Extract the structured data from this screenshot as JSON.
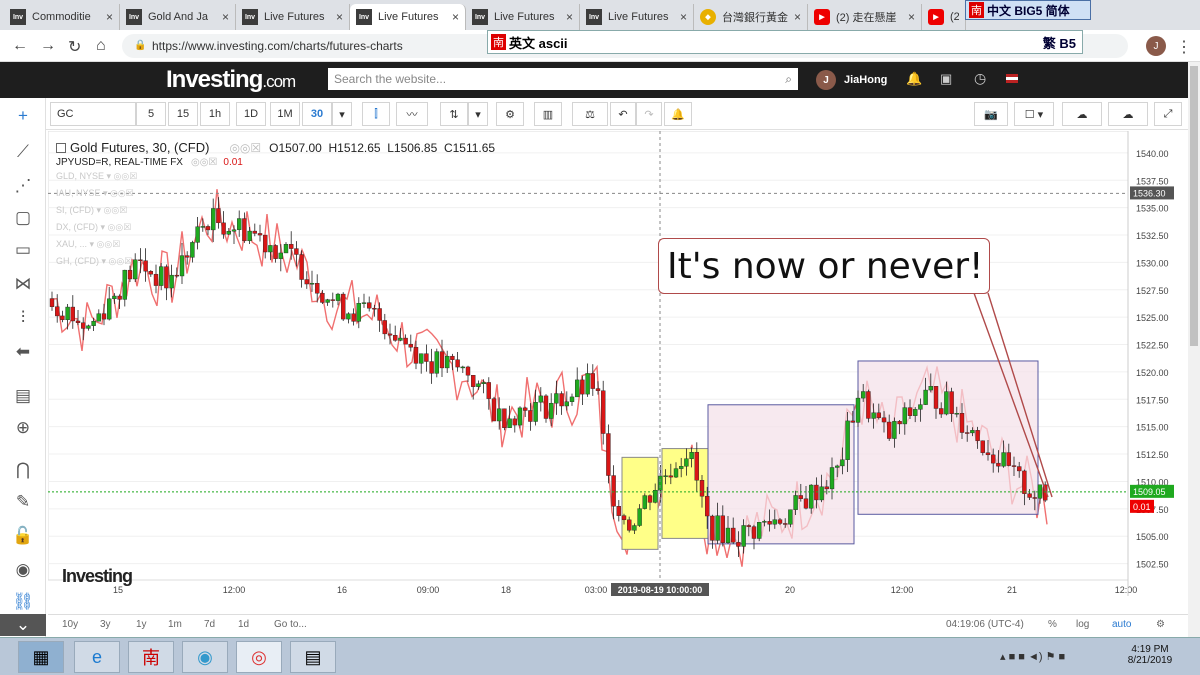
{
  "tabs": [
    {
      "fav": "Inv",
      "title": "Commoditie",
      "x": 4,
      "w": 116
    },
    {
      "fav": "Inv",
      "title": "Gold And Ja",
      "x": 120,
      "w": 116
    },
    {
      "fav": "Inv",
      "title": "Live Futures",
      "x": 236,
      "w": 114
    },
    {
      "fav": "Inv",
      "title": "Live Futures",
      "x": 350,
      "w": 116,
      "active": true
    },
    {
      "fav": "Inv",
      "title": "Live Futures",
      "x": 466,
      "w": 114
    },
    {
      "fav": "Inv",
      "title": "Live Futures",
      "x": 580,
      "w": 114
    },
    {
      "fav": "gem",
      "title": "台灣銀行黃金",
      "x": 694,
      "w": 114
    },
    {
      "fav": "yt",
      "title": "(2) 走在懸崖",
      "x": 808,
      "w": 114
    },
    {
      "fav": "yt",
      "title": "(2)",
      "x": 922,
      "w": 44
    }
  ],
  "ime_top": {
    "nan": "南",
    "text": "中文 BIG5 简体"
  },
  "ime_bar": {
    "nan": "南",
    "text": "英文 ascii",
    "right": "繁 B5"
  },
  "browser": {
    "url": "https://www.investing.com/charts/futures-charts"
  },
  "site": {
    "logo": "Investing",
    "logo_suffix": ".com",
    "search_placeholder": "Search the website...",
    "user_initial": "J",
    "user_name": "JiaHong"
  },
  "toolbar": {
    "symbol": "GC",
    "intervals": [
      "5",
      "15",
      "1h",
      "1D",
      "1M",
      "30"
    ],
    "active_interval": "30"
  },
  "legend": {
    "title": "Gold Futures, 30, (CFD)",
    "ohlc": "O1507.00  H1512.65  L1506.85  C1511.65",
    "overlay": "JPYUSD=R, REAL-TIME FX",
    "overlay_val": "0.01",
    "faded": [
      "GLD, NYSE",
      "IAU, NYSE",
      "SI, (CFD)",
      "DX, (CFD)",
      "XAU, ...",
      "GH, (CFD)"
    ]
  },
  "annotation": {
    "text": "It's now or never!"
  },
  "chart_data": {
    "type": "candlestick",
    "ylabels": [
      "1540.00",
      "1537.50",
      "1535.00",
      "1532.50",
      "1530.00",
      "1527.50",
      "1525.00",
      "1522.50",
      "1520.00",
      "1517.50",
      "1515.00",
      "1512.50",
      "1510.00",
      "1507.50",
      "1505.00",
      "1502.50"
    ],
    "xlabels": [
      "15",
      "12:00",
      "16",
      "09:00",
      "18",
      "03:00",
      "20",
      "12:00",
      "21",
      "12:00"
    ],
    "crosshair_x_label": "2019-08-19 10:00:00",
    "crosshair_y_label": "1536.30",
    "last_price_label": "1509.05",
    "overlay_label": "0.01",
    "colors": {
      "up": "#1fa91f",
      "down": "#d91616",
      "overlay": "#f07070",
      "box_yellow": "#ffff88",
      "box_pink": "#f4e0e8"
    },
    "ylim": [
      1501,
      1542
    ]
  },
  "watermark": {
    "text": "Investing",
    ".com": ".com"
  },
  "bottom": {
    "ranges": [
      "10y",
      "3y",
      "1y",
      "1m",
      "7d",
      "1d",
      "Go to..."
    ],
    "time": "04:19:06 (UTC-4)",
    "pct": "%",
    "log": "log",
    "auto": "auto"
  },
  "clock": {
    "time": "4:19 PM",
    "date": "8/21/2019"
  }
}
